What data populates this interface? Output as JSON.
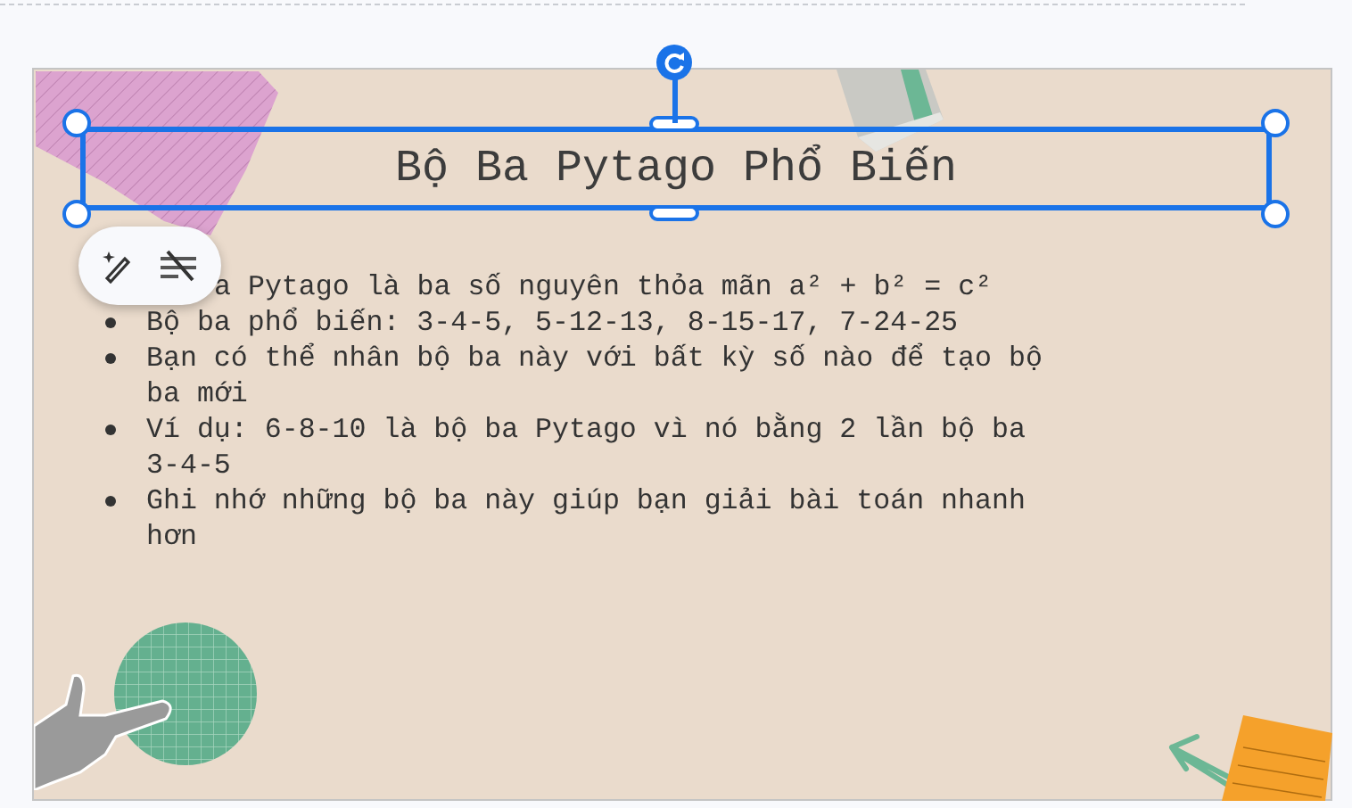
{
  "slide": {
    "title": "Bộ Ba Pytago Phổ Biến",
    "bullets": [
      {
        "text": "a Pytago là ba số nguyên thỏa mãn a² + b² = c²",
        "covered": true
      },
      {
        "text": "Bộ ba phổ biến: 3-4-5, 5-12-13, 8-15-17, 7-24-25",
        "covered": false
      },
      {
        "text": "Bạn có thể nhân bộ ba này với bất kỳ số nào để tạo bộ ba mới",
        "covered": false
      },
      {
        "text": "Ví dụ: 6-8-10 là bộ ba Pytago vì nó bằng 2 lần bộ ba 3-4-5",
        "covered": false
      },
      {
        "text": "Ghi nhớ những bộ ba này giúp bạn giải bài toán nhanh hơn",
        "covered": false
      }
    ]
  }
}
